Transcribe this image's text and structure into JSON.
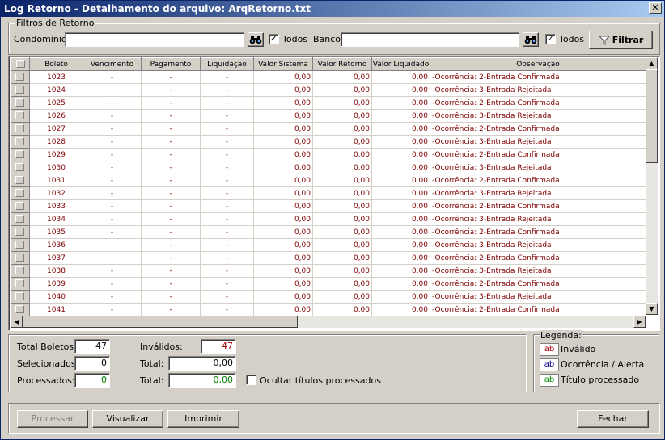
{
  "window": {
    "title": "Log Retorno - Detalhamento do arquivo: ArqRetorno.txt",
    "close_glyph": "✕"
  },
  "filters": {
    "legend": "Filtros de Retorno",
    "condominio_label": "Condomínio:",
    "condominio_value": "",
    "todos_label_1": "Todos",
    "todos_checked_1": "✓",
    "banco_label": "Banco:",
    "banco_value": "",
    "todos_label_2": "Todos",
    "todos_checked_2": "✓",
    "filtrar_label": "Filtrar"
  },
  "grid": {
    "columns": [
      "Boleto",
      "Vencimento",
      "Pagamento",
      "Liquidação",
      "Valor Sistema",
      "Valor Retorno",
      "Valor Liquidado",
      "Observação"
    ],
    "rows": [
      [
        "1023",
        "-",
        "-",
        "-",
        "0,00",
        "0,00",
        "0,00",
        "-Ocorrência: 2-Entrada Confirmada"
      ],
      [
        "1024",
        "-",
        "-",
        "-",
        "0,00",
        "0,00",
        "0,00",
        "-Ocorrência: 3-Entrada Rejeitada"
      ],
      [
        "1025",
        "-",
        "-",
        "-",
        "0,00",
        "0,00",
        "0,00",
        "-Ocorrência: 2-Entrada Confirmada"
      ],
      [
        "1026",
        "-",
        "-",
        "-",
        "0,00",
        "0,00",
        "0,00",
        "-Ocorrência: 3-Entrada Rejeitada"
      ],
      [
        "1027",
        "-",
        "-",
        "-",
        "0,00",
        "0,00",
        "0,00",
        "-Ocorrência: 2-Entrada Confirmada"
      ],
      [
        "1028",
        "-",
        "-",
        "-",
        "0,00",
        "0,00",
        "0,00",
        "-Ocorrência: 3-Entrada Rejeitada"
      ],
      [
        "1029",
        "-",
        "-",
        "-",
        "0,00",
        "0,00",
        "0,00",
        "-Ocorrência: 2-Entrada Confirmada"
      ],
      [
        "1030",
        "-",
        "-",
        "-",
        "0,00",
        "0,00",
        "0,00",
        "-Ocorrência: 3-Entrada Rejeitada"
      ],
      [
        "1031",
        "-",
        "-",
        "-",
        "0,00",
        "0,00",
        "0,00",
        "-Ocorrência: 2-Entrada Confirmada"
      ],
      [
        "1032",
        "-",
        "-",
        "-",
        "0,00",
        "0,00",
        "0,00",
        "-Ocorrência: 3-Entrada Rejeitada"
      ],
      [
        "1033",
        "-",
        "-",
        "-",
        "0,00",
        "0,00",
        "0,00",
        "-Ocorrência: 2-Entrada Confirmada"
      ],
      [
        "1034",
        "-",
        "-",
        "-",
        "0,00",
        "0,00",
        "0,00",
        "-Ocorrência: 3-Entrada Rejeitada"
      ],
      [
        "1035",
        "-",
        "-",
        "-",
        "0,00",
        "0,00",
        "0,00",
        "-Ocorrência: 2-Entrada Confirmada"
      ],
      [
        "1036",
        "-",
        "-",
        "-",
        "0,00",
        "0,00",
        "0,00",
        "-Ocorrência: 3-Entrada Rejeitada"
      ],
      [
        "1037",
        "-",
        "-",
        "-",
        "0,00",
        "0,00",
        "0,00",
        "-Ocorrência: 2-Entrada Confirmada"
      ],
      [
        "1038",
        "-",
        "-",
        "-",
        "0,00",
        "0,00",
        "0,00",
        "-Ocorrência: 3-Entrada Rejeitada"
      ],
      [
        "1039",
        "-",
        "-",
        "-",
        "0,00",
        "0,00",
        "0,00",
        "-Ocorrência: 2-Entrada Confirmada"
      ],
      [
        "1040",
        "-",
        "-",
        "-",
        "0,00",
        "0,00",
        "0,00",
        "-Ocorrência: 3-Entrada Rejeitada"
      ],
      [
        "1041",
        "-",
        "-",
        "-",
        "0,00",
        "0,00",
        "0,00",
        "-Ocorrência: 2-Entrada Confirmada"
      ]
    ],
    "scroll_up": "▲",
    "scroll_down": "▼",
    "scroll_left": "◀",
    "scroll_right": "▶"
  },
  "summary": {
    "total_boletos_label": "Total Boletos:",
    "total_boletos_value": "47",
    "selecionados_label": "Selecionados:",
    "selecionados_value": "0",
    "processados_label": "Processados:",
    "processados_value": "0",
    "invalidos_label": "Inválidos:",
    "invalidos_value": "47",
    "total_label_1": "Total:",
    "total_value_1": "0,00",
    "total_label_2": "Total:",
    "total_value_2": "0,00",
    "ocultar_label": "Ocultar títulos processados"
  },
  "legend": {
    "title": "Legenda:",
    "items": [
      {
        "swatch": "ab",
        "label": "Inválido",
        "color": "#a00000"
      },
      {
        "swatch": "ab",
        "label": "Ocorrência / Alerta",
        "color": "#000080"
      },
      {
        "swatch": "ab",
        "label": "Título processado",
        "color": "#008000"
      }
    ]
  },
  "buttons": {
    "processar": "Processar",
    "visualizar": "Visualizar",
    "imprimir": "Imprimir",
    "fechar": "Fechar"
  },
  "colors": {
    "title_start": "#0a246a",
    "row_text": "#800000"
  }
}
